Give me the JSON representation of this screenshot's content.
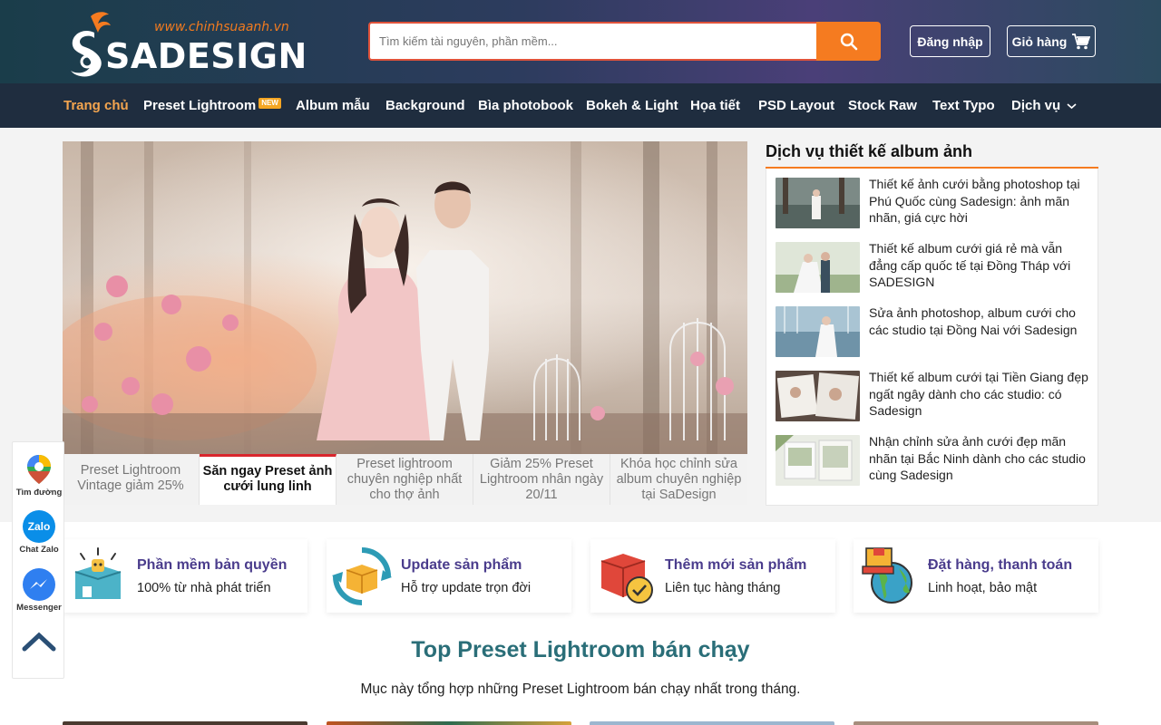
{
  "header": {
    "logo_url_text": "www.chinhsuaanh.vn",
    "logo_text": "SADESIGN",
    "search_placeholder": "Tìm kiếm tài nguyên, phần mềm...",
    "login_label": "Đăng nhập",
    "cart_label": "Giỏ hàng"
  },
  "nav": {
    "items": [
      "Trang chủ",
      "Preset Lightroom",
      "Album mẫu",
      "Background",
      "Bìa photobook",
      "Bokeh & Light",
      "Họa tiết",
      "PSD Layout",
      "Stock Raw",
      "Text Typo",
      "Dịch vụ"
    ],
    "new_badge": "NEW",
    "active_index": 0
  },
  "slider": {
    "active_slide": 2,
    "slide_count": 5,
    "tabs": [
      "Preset Lightroom Vintage giảm 25%",
      "Săn ngay Preset ảnh cưới lung linh",
      "Preset lightroom chuyên nghiệp nhất cho thợ ảnh",
      "Giảm 25% Preset Lightroom nhân ngày 20/11",
      "Khóa học chỉnh sửa album chuyên nghiệp tại SaDesign"
    ],
    "active_tab": 1
  },
  "sidebar": {
    "title": "Dịch vụ thiết kế album ảnh",
    "items": [
      "Thiết kế ảnh cưới bằng photoshop tại Phú Quốc cùng Sadesign: ảnh mãn nhãn, giá cực hời",
      "Thiết kế album cưới giá rẻ mà vẫn đẳng cấp quốc tế tại Đồng Tháp với SADESIGN",
      "Sửa ảnh photoshop, album cưới cho các studio tại Đồng Nai với Sadesign",
      "Thiết kế album cưới tại Tiền Giang đẹp ngất ngây dành cho các studio: có Sadesign",
      "Nhận chỉnh sửa ảnh cưới đẹp mãn nhãn tại Bắc Ninh dành cho các studio cùng Sadesign"
    ]
  },
  "features": [
    {
      "title": "Phần mềm bản quyền",
      "subtitle": "100% từ nhà phát triển",
      "icon": "software-box-icon"
    },
    {
      "title": "Update sản phẩm",
      "subtitle": "Hỗ trợ update trọn đời",
      "icon": "update-box-icon"
    },
    {
      "title": "Thêm mới sản phẩm",
      "subtitle": "Liên tục hàng tháng",
      "icon": "new-product-icon"
    },
    {
      "title": "Đặt hàng, thanh toán",
      "subtitle": "Linh hoạt, bảo mật",
      "icon": "global-order-icon"
    }
  ],
  "top_section": {
    "title": "Top Preset Lightroom bán chạy",
    "description": "Mục này tổng hợp những Preset Lightroom bán chạy nhất trong tháng."
  },
  "floating": {
    "map_label": "Tìm đường",
    "zalo_label": "Chat Zalo",
    "zalo_icon_text": "Zalo",
    "messenger_label": "Messenger"
  },
  "colors": {
    "accent_orange": "#f57b20",
    "nav_bg": "#1f2d3f",
    "feature_title": "#4a3c8c",
    "section_title": "#2a6e78",
    "active_tab_border": "#d9262d"
  }
}
